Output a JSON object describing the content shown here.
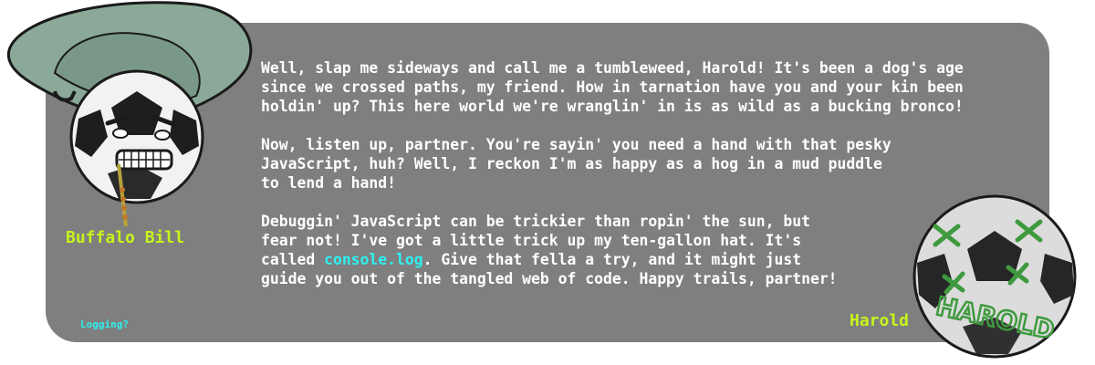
{
  "left_character": {
    "name": "Buffalo Bill",
    "icon": "cowboy-soccer-ball-icon"
  },
  "right_character": {
    "name": "Harold",
    "ball_scrawl": "HAROLD",
    "icon": "soccer-ball-icon"
  },
  "message": {
    "paragraph_1": "Well, slap me sideways and call me a tumbleweed, Harold! It's been a dog's age\nsince we crossed paths, my friend. How in tarnation have you and your kin been\nholdin' up? This here world we're wranglin' in is as wild as a bucking bronco!",
    "paragraph_2": "Now, listen up, partner. You're sayin' you need a hand with that pesky\nJavaScript, huh? Well, I reckon I'm as happy as a hog in a mud puddle\nto lend a hand!",
    "paragraph_3_before": "Debuggin' JavaScript can be trickier than ropin' the sun, but\nfear not! I've got a little trick up my ten-gallon hat. It's\ncalled ",
    "paragraph_3_code": "console.log",
    "paragraph_3_after": ". Give that fella a try, and it might just\nguide you out of the tangled web of code. Happy trails, partner!"
  },
  "footnote": "Logging?",
  "colors": {
    "panel": "#7f7f7f",
    "name": "#c6f51a",
    "code": "#2ef0f0",
    "text": "#ffffff",
    "hat": "#8ba998",
    "scrawl": "#3f9a3f"
  }
}
